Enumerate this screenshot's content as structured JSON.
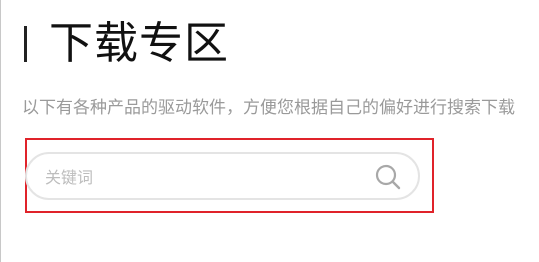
{
  "header": {
    "title": "下载专区",
    "subtitle": "以下有各种产品的驱动软件，方便您根据自己的偏好进行搜索下载"
  },
  "search": {
    "placeholder": "关键词",
    "value": "",
    "icon": "search-icon"
  },
  "colors": {
    "highlight_border": "#e0232a",
    "title_bar": "#222222",
    "subtitle_text": "#9a9a9a",
    "search_border": "#e4e4e4"
  }
}
